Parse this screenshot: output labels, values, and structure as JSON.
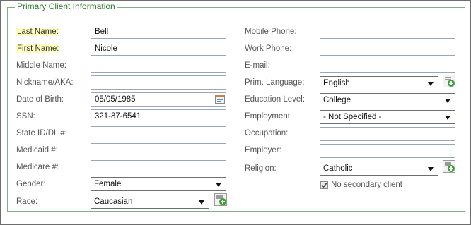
{
  "section": {
    "title": "Primary Client Information"
  },
  "left": {
    "last_name": {
      "label": "Last Name:",
      "value": "Bell"
    },
    "first_name": {
      "label": "First Name:",
      "value": "Nicole"
    },
    "middle_name": {
      "label": "Middle Name:",
      "value": ""
    },
    "nickname": {
      "label": "Nickname/AKA:",
      "value": ""
    },
    "dob": {
      "label": "Date of Birth:",
      "value": "05/05/1985"
    },
    "ssn": {
      "label": "SSN:",
      "value": "321-87-6541"
    },
    "state_id": {
      "label": "State ID/DL #:",
      "value": ""
    },
    "medicaid": {
      "label": "Medicaid #:",
      "value": ""
    },
    "medicare": {
      "label": "Medicare #:",
      "value": ""
    },
    "gender": {
      "label": "Gender:",
      "value": "Female"
    },
    "race": {
      "label": "Race:",
      "value": "Caucasian"
    }
  },
  "right": {
    "mobile_phone": {
      "label": "Mobile Phone:",
      "value": ""
    },
    "work_phone": {
      "label": "Work Phone:",
      "value": ""
    },
    "email": {
      "label": "E-mail:",
      "value": ""
    },
    "language": {
      "label": "Prim. Language:",
      "value": "English"
    },
    "education": {
      "label": "Education Level:",
      "value": "College"
    },
    "employment": {
      "label": "Employment:",
      "value": "- Not Specified -"
    },
    "occupation": {
      "label": "Occupation:",
      "value": ""
    },
    "employer": {
      "label": "Employer:",
      "value": ""
    },
    "religion": {
      "label": "Religion:",
      "value": "Catholic"
    },
    "no_secondary": {
      "label": "No secondary client",
      "checked": true
    }
  },
  "icons": {
    "add": "add-item-icon",
    "calendar": "calendar-icon",
    "dropdown": "chevron-down-icon",
    "checkmark": "checkmark-icon"
  },
  "colors": {
    "legend_text": "#2f7a2f",
    "fieldset_border": "#7faf7f",
    "required_highlight": "#ffffc0",
    "add_icon_green": "#3aa13a"
  }
}
